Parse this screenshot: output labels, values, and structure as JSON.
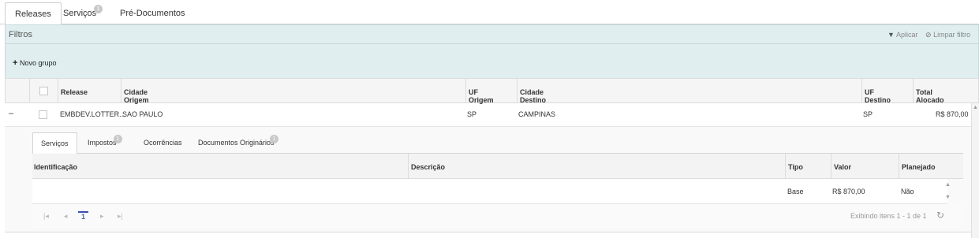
{
  "tabs": [
    {
      "label": "Releases",
      "active": true
    },
    {
      "label": "Serviços",
      "badge": "1"
    },
    {
      "label": "Pré-Documentos"
    }
  ],
  "filters": {
    "title": "Filtros",
    "apply": "Aplicar",
    "clear": "Limpar filtro"
  },
  "group": {
    "new_group": "Novo grupo"
  },
  "grid": {
    "headers": [
      "Release",
      "Cidade Origem",
      "UF Origem",
      "Cidade Destino",
      "UF Destino",
      "Total Alocado"
    ],
    "row": {
      "expander": "–",
      "release": "EMBDEV.LOTTER...",
      "cidade_origem": "SAO PAULO",
      "uf_origem": "SP",
      "cidade_destino": "CAMPINAS",
      "uf_destino": "SP",
      "total": "R$ 870,00"
    }
  },
  "detail": {
    "tabs": [
      {
        "label": "Serviços",
        "active": true
      },
      {
        "label": "Impostos",
        "badge": "1"
      },
      {
        "label": "Ocorrências"
      },
      {
        "label": "Documentos Originários",
        "badge": "1"
      }
    ],
    "headers": [
      "Identificação",
      "Descrição",
      "Tipo",
      "Valor",
      "Planejado"
    ],
    "row": {
      "identificacao": "",
      "descricao": "",
      "tipo": "Base",
      "valor": "R$ 870,00",
      "planejado": "Não"
    },
    "pager": {
      "page": "1",
      "info": "Exibindo itens 1 - 1 de 1"
    }
  }
}
